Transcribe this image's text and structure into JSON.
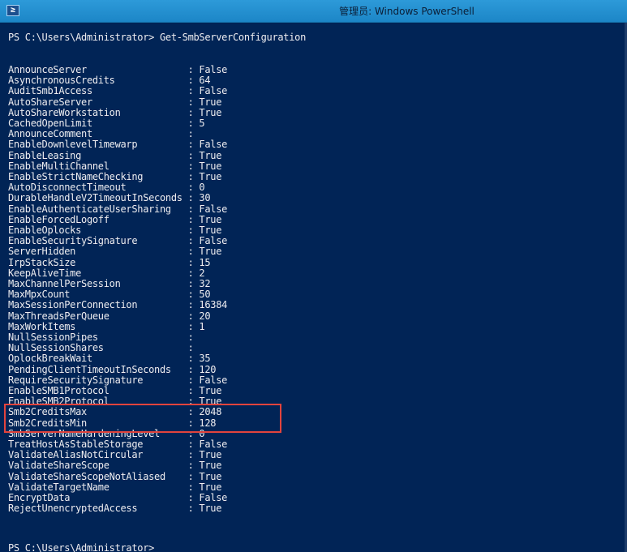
{
  "window": {
    "title": "管理员: Windows PowerShell",
    "app_icon_glyph": "≥"
  },
  "console": {
    "command_prompt": "PS C:\\Users\\Administrator> Get-SmbServerConfiguration",
    "end_prompt": "PS C:\\Users\\Administrator>",
    "properties": [
      {
        "name": "AnnounceServer",
        "value": "False"
      },
      {
        "name": "AsynchronousCredits",
        "value": "64"
      },
      {
        "name": "AuditSmb1Access",
        "value": "False"
      },
      {
        "name": "AutoShareServer",
        "value": "True"
      },
      {
        "name": "AutoShareWorkstation",
        "value": "True"
      },
      {
        "name": "CachedOpenLimit",
        "value": "5"
      },
      {
        "name": "AnnounceComment",
        "value": ""
      },
      {
        "name": "EnableDownlevelTimewarp",
        "value": "False"
      },
      {
        "name": "EnableLeasing",
        "value": "True"
      },
      {
        "name": "EnableMultiChannel",
        "value": "True"
      },
      {
        "name": "EnableStrictNameChecking",
        "value": "True"
      },
      {
        "name": "AutoDisconnectTimeout",
        "value": "0"
      },
      {
        "name": "DurableHandleV2TimeoutInSeconds",
        "value": "30"
      },
      {
        "name": "EnableAuthenticateUserSharing",
        "value": "False"
      },
      {
        "name": "EnableForcedLogoff",
        "value": "True"
      },
      {
        "name": "EnableOplocks",
        "value": "True"
      },
      {
        "name": "EnableSecuritySignature",
        "value": "False"
      },
      {
        "name": "ServerHidden",
        "value": "True"
      },
      {
        "name": "IrpStackSize",
        "value": "15"
      },
      {
        "name": "KeepAliveTime",
        "value": "2"
      },
      {
        "name": "MaxChannelPerSession",
        "value": "32"
      },
      {
        "name": "MaxMpxCount",
        "value": "50"
      },
      {
        "name": "MaxSessionPerConnection",
        "value": "16384"
      },
      {
        "name": "MaxThreadsPerQueue",
        "value": "20"
      },
      {
        "name": "MaxWorkItems",
        "value": "1"
      },
      {
        "name": "NullSessionPipes",
        "value": ""
      },
      {
        "name": "NullSessionShares",
        "value": ""
      },
      {
        "name": "OplockBreakWait",
        "value": "35"
      },
      {
        "name": "PendingClientTimeoutInSeconds",
        "value": "120"
      },
      {
        "name": "RequireSecuritySignature",
        "value": "False"
      },
      {
        "name": "EnableSMB1Protocol",
        "value": "True"
      },
      {
        "name": "EnableSMB2Protocol",
        "value": "True"
      },
      {
        "name": "Smb2CreditsMax",
        "value": "2048"
      },
      {
        "name": "Smb2CreditsMin",
        "value": "128"
      },
      {
        "name": "SmbServerNameHardeningLevel",
        "value": "0"
      },
      {
        "name": "TreatHostAsStableStorage",
        "value": "False"
      },
      {
        "name": "ValidateAliasNotCircular",
        "value": "True"
      },
      {
        "name": "ValidateShareScope",
        "value": "True"
      },
      {
        "name": "ValidateShareScopeNotAliased",
        "value": "True"
      },
      {
        "name": "ValidateTargetName",
        "value": "True"
      },
      {
        "name": "EncryptData",
        "value": "False"
      },
      {
        "name": "RejectUnencryptedAccess",
        "value": "True"
      }
    ]
  },
  "colors": {
    "console_background": "#012456",
    "console_text": "#eeedf0",
    "titlebar": "#1c86c7",
    "highlight_box": "#e2443d"
  }
}
